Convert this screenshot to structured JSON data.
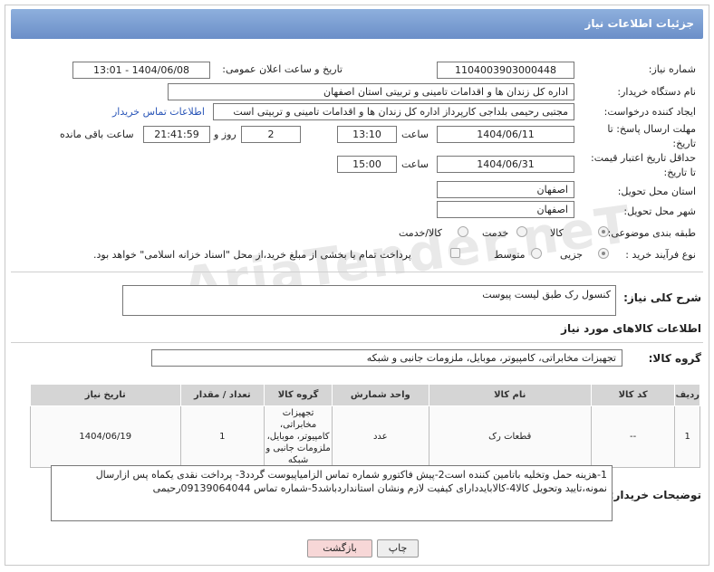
{
  "header": {
    "title": "جزئیات اطلاعات نیاز"
  },
  "fields": {
    "need_number_label": "شماره نیاز:",
    "need_number": "1104003903000448",
    "announce_label": "تاریخ و ساعت اعلان عمومی:",
    "announce_value": "1404/06/08 - 13:01",
    "buyer_org_label": "نام دستگاه خریدار:",
    "buyer_org": "اداره کل زندان ها و اقدامات تامینی و تربیتی استان اصفهان",
    "requester_label": "ایجاد کننده درخواست:",
    "requester": "مجتبی رحیمی بلداجی کارپرداز اداره کل زندان ها و اقدامات تامینی و تربیتی است",
    "buyer_contact_link": "اطلاعات تماس خریدار",
    "reply_deadline_label": "مهلت ارسال پاسخ: تا تاریخ:",
    "reply_date": "1404/06/11",
    "time_label": "ساعت",
    "reply_time": "13:10",
    "days_count": "2",
    "days_label": "روز و",
    "remaining_time": "21:41:59",
    "remaining_label": "ساعت باقی مانده",
    "price_validity_label": "حداقل تاریخ اعتبار قیمت: تا تاریخ:",
    "validity_date": "1404/06/31",
    "validity_time": "15:00",
    "province_label": "استان محل تحویل:",
    "province": "اصفهان",
    "city_label": "شهر محل تحویل:",
    "city": "اصفهان",
    "category_label": "طبقه بندی موضوعی:",
    "category_goods": "کالا",
    "category_service": "خدمت",
    "category_both": "کالا/خدمت",
    "process_label": "نوع فرآیند خرید :",
    "process_partial": "جزیی",
    "process_medium": "متوسط",
    "payment_note": "پرداخت تمام یا بخشی از مبلغ خرید،از محل \"اسناد خزانه اسلامی\" خواهد بود.",
    "summary_label": "شرح کلی نیاز:",
    "summary": "کنسول رک طبق لیست پیوست",
    "goods_info_title": "اطلاعات کالاهای مورد نیاز",
    "goods_group_label": "گروه کالا:",
    "goods_group": "تجهیزات مخابراتی، کامپیوتر، موبایل، ملزومات جانبی و شبکه",
    "buyer_notes_label": "توضیحات خریدار:",
    "buyer_notes": "1-هزینه حمل وتخلیه باتامین کننده است2-پیش فاکتورو شماره تماس الزامیاپیوست گردد3- پرداخت نقدی یکماه  پس ازارسال نمونه،تایید وتحویل کالا4-کالابایددارای کیفیت لازم ونشان استانداردباشد5-شماره تماس 09139064044رحیمی"
  },
  "table": {
    "headers": [
      "ردیف",
      "کد کالا",
      "نام کالا",
      "واحد شمارش",
      "گروه کالا",
      "تعداد / مقدار",
      "تاریخ نیاز"
    ],
    "rows": [
      {
        "row": "1",
        "code": "--",
        "name": "قطعات رک",
        "unit": "عدد",
        "group": "تجهیزات مخابراتی، کامپیوتر، موبایل، ملزومات جانبی و شبکه",
        "qty": "1",
        "date": "1404/06/19"
      }
    ]
  },
  "buttons": {
    "print": "چاپ",
    "back": "بازگشت"
  },
  "watermark": "AriaTender.neT",
  "colors": {
    "header_bg": "#7b9bd0",
    "link": "#2a56b8",
    "back_button": "#f7d7d7"
  }
}
